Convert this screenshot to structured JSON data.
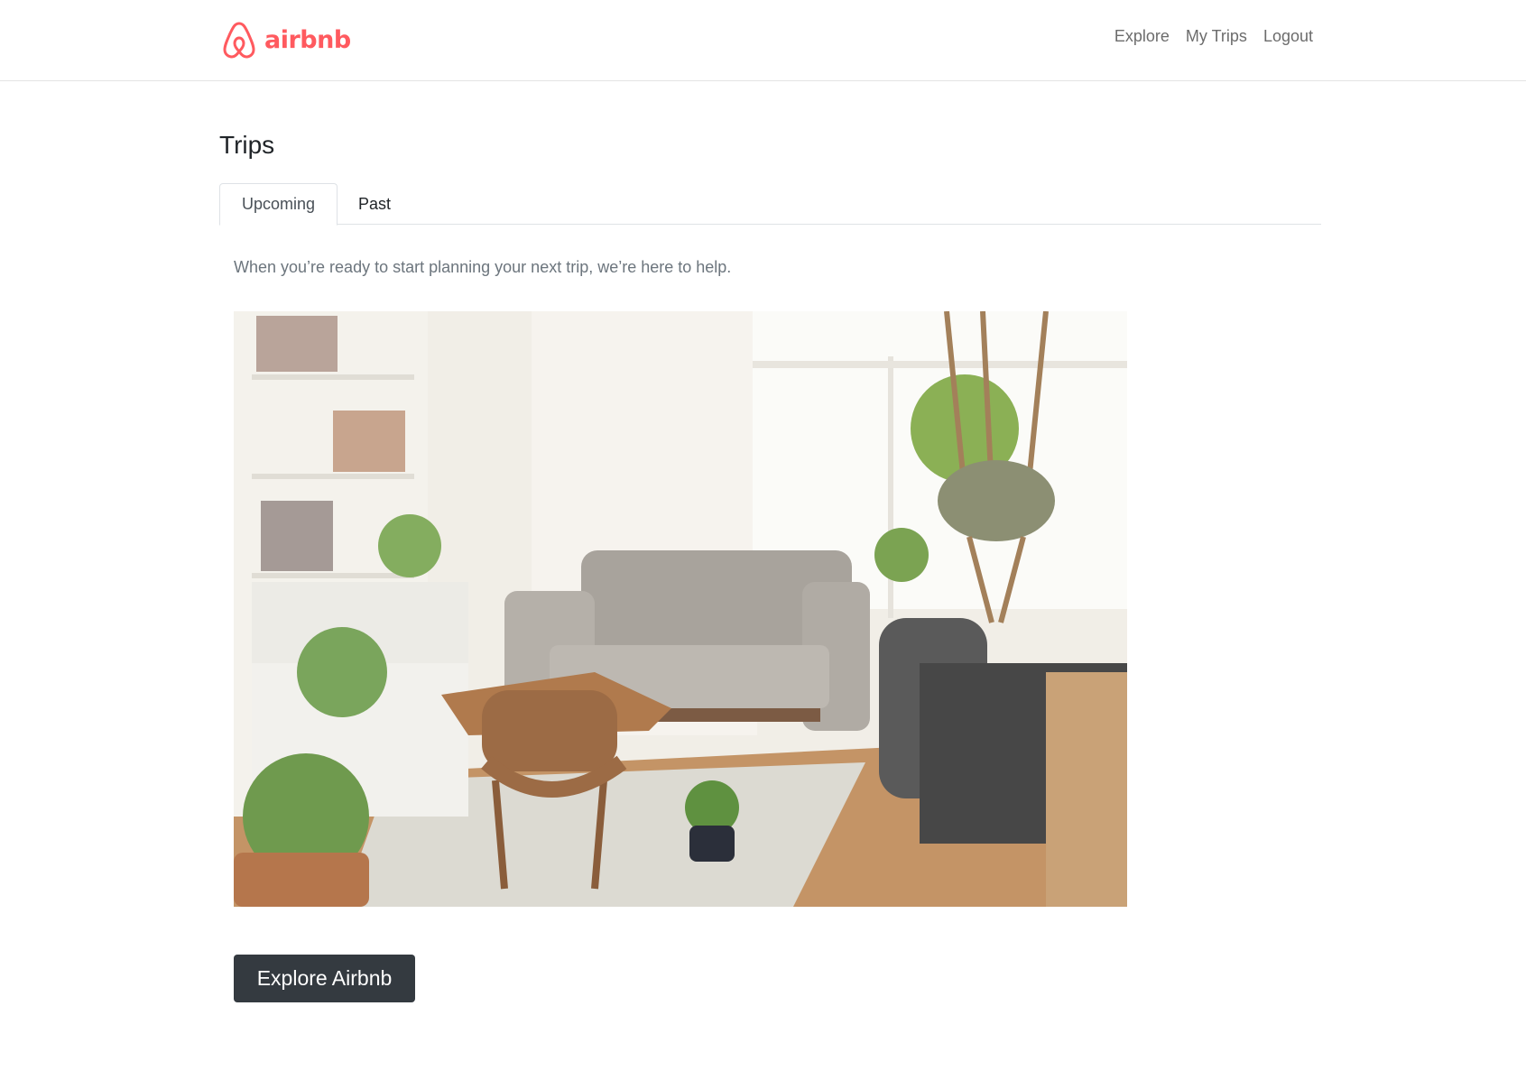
{
  "nav": {
    "brand": "airbnb",
    "links": [
      "Explore",
      "My Trips",
      "Logout"
    ]
  },
  "main": {
    "title": "Trips",
    "tabs": [
      {
        "label": "Upcoming",
        "active": true
      },
      {
        "label": "Past",
        "active": false
      }
    ],
    "empty_message": "When you’re ready to start planning your next trip, we’re here to help.",
    "cta_label": "Explore Airbnb"
  },
  "colors": {
    "brand": "#ff5a5f",
    "button": "#343a40"
  }
}
